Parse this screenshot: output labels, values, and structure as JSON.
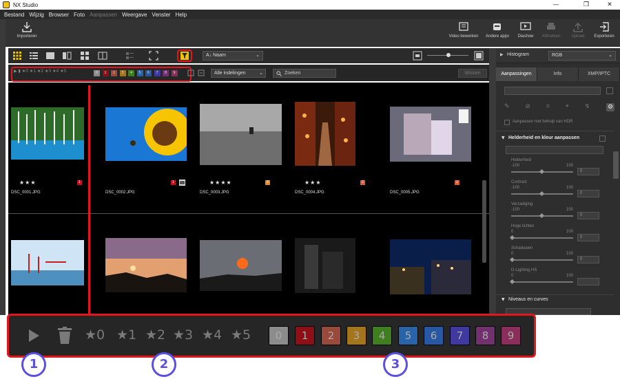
{
  "window": {
    "title": "NX Studio",
    "minimize": "—",
    "maximize": "❐",
    "close": "✕"
  },
  "menu": {
    "items": [
      "Bestand",
      "Wijzig",
      "Browser",
      "Foto",
      "Aanpassen",
      "Weergave",
      "Venster",
      "Help"
    ],
    "disabled_item": "Aanpassen"
  },
  "toolbar": {
    "import_label": "Importeren",
    "video_label": "Video bewerken",
    "apps_label": "Andere apps",
    "slideshow_label": "Diashow",
    "print_label": "Afdrukken",
    "upload_label": "Upload",
    "export_label": "Exporteren"
  },
  "viewbar": {
    "sort_value": "Naam",
    "sort_prefix": "A↓"
  },
  "filterbar": {
    "small_symbols": "▶  ▮  ★0 ★1 ★2 ★3 ★4 ★5",
    "layout_value": "Alle indelingen",
    "search_placeholder": "Zoeken",
    "clear_label": "Wissen"
  },
  "photos": [
    {
      "name": "DSC_0001.JPG",
      "stars": "★★★",
      "label": "1",
      "label_color": "#c1121f"
    },
    {
      "name": "DSC_0002.JPG",
      "stars": "",
      "label": "1",
      "label_color": "#c1121f"
    },
    {
      "name": "DSC_0003.JPG",
      "stars": "★★★★",
      "label": "3",
      "label_color": "#e58a1f"
    },
    {
      "name": "DSC_0004.JPG",
      "stars": "★★★",
      "label": "2",
      "label_color": "#d9593b"
    },
    {
      "name": "DSC_0005.JPG",
      "stars": "",
      "label": "2",
      "label_color": "#d9593b"
    }
  ],
  "right_panel": {
    "histogram_label": "Histogram",
    "histogram_mode": "RGB",
    "tabs": [
      "Aanpassingen",
      "Info",
      "XMP/IPTC"
    ],
    "hdr_label": "Aanpassen met behulp van HDR",
    "section_color": "Helderheid en kleur aanpassen",
    "sliders": [
      {
        "label": "Helderheid",
        "min": "-100",
        "max": "100",
        "value": "0"
      },
      {
        "label": "Contrast",
        "min": "-100",
        "max": "100",
        "value": "0"
      },
      {
        "label": "Verzadiging",
        "min": "-100",
        "max": "100",
        "value": "0"
      },
      {
        "label": "Hoge lichten",
        "min": "0",
        "max": "100",
        "value": "0"
      },
      {
        "label": "Schaduwen",
        "min": "0",
        "max": "100",
        "value": "0"
      },
      {
        "label": "D-Lighting HS",
        "min": "0",
        "max": "100",
        "value": ""
      }
    ],
    "section_levels": "Niveaus en curves"
  },
  "zoom_filter": {
    "stars": [
      "★0",
      "★1",
      "★2",
      "★3",
      "★4",
      "★5"
    ],
    "labels": [
      {
        "text": "0",
        "color": "#8c8c8c"
      },
      {
        "text": "1",
        "color": "#8e1017"
      },
      {
        "text": "2",
        "color": "#9a4a3a"
      },
      {
        "text": "3",
        "color": "#a5751c"
      },
      {
        "text": "4",
        "color": "#3f7f1f"
      },
      {
        "text": "5",
        "color": "#2a64a8"
      },
      {
        "text": "6",
        "color": "#2658a3"
      },
      {
        "text": "7",
        "color": "#403aa0"
      },
      {
        "text": "8",
        "color": "#72306f"
      },
      {
        "text": "9",
        "color": "#8a2e5c"
      }
    ]
  },
  "callouts": [
    "1",
    "2",
    "3"
  ]
}
